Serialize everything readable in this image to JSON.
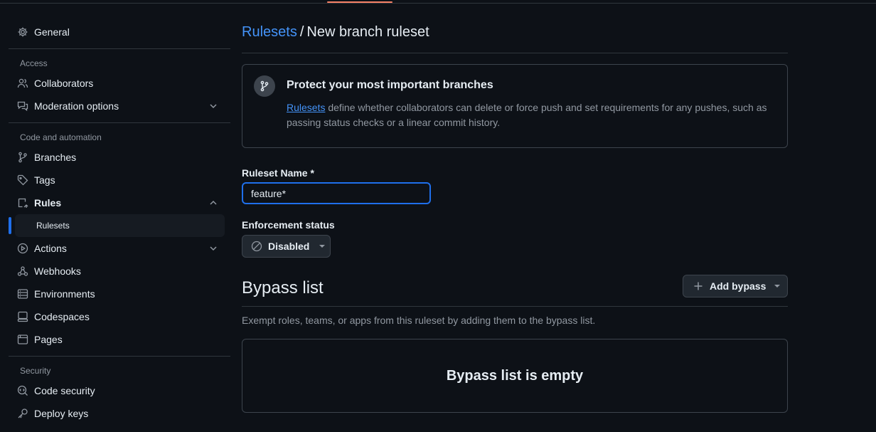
{
  "sidebar": {
    "general": "General",
    "groups": {
      "access": "Access",
      "code_automation": "Code and automation",
      "security": "Security"
    },
    "items": {
      "collaborators": "Collaborators",
      "moderation": "Moderation options",
      "branches": "Branches",
      "tags": "Tags",
      "rules": "Rules",
      "rulesets": "Rulesets",
      "actions": "Actions",
      "webhooks": "Webhooks",
      "environments": "Environments",
      "codespaces": "Codespaces",
      "pages": "Pages",
      "code_security": "Code security",
      "deploy_keys": "Deploy keys"
    }
  },
  "breadcrumb": {
    "parent": "Rulesets",
    "separator": "/",
    "current": "New branch ruleset"
  },
  "info": {
    "title": "Protect your most important branches",
    "link": "Rulesets",
    "description": " define whether collaborators can delete or force push and set requirements for any pushes, such as passing status checks or a linear commit history."
  },
  "form": {
    "name_label": "Ruleset Name *",
    "name_value": "feature*",
    "enforcement_label": "Enforcement status",
    "enforcement_value": "Disabled"
  },
  "bypass": {
    "title": "Bypass list",
    "add_button": "Add bypass",
    "description": "Exempt roles, teams, or apps from this ruleset by adding them to the bypass list.",
    "empty": "Bypass list is empty"
  },
  "colors": {
    "accent": "#4493f8",
    "focus": "#1f6feb",
    "tab_underline": "#f78166",
    "background": "#0d1117"
  }
}
